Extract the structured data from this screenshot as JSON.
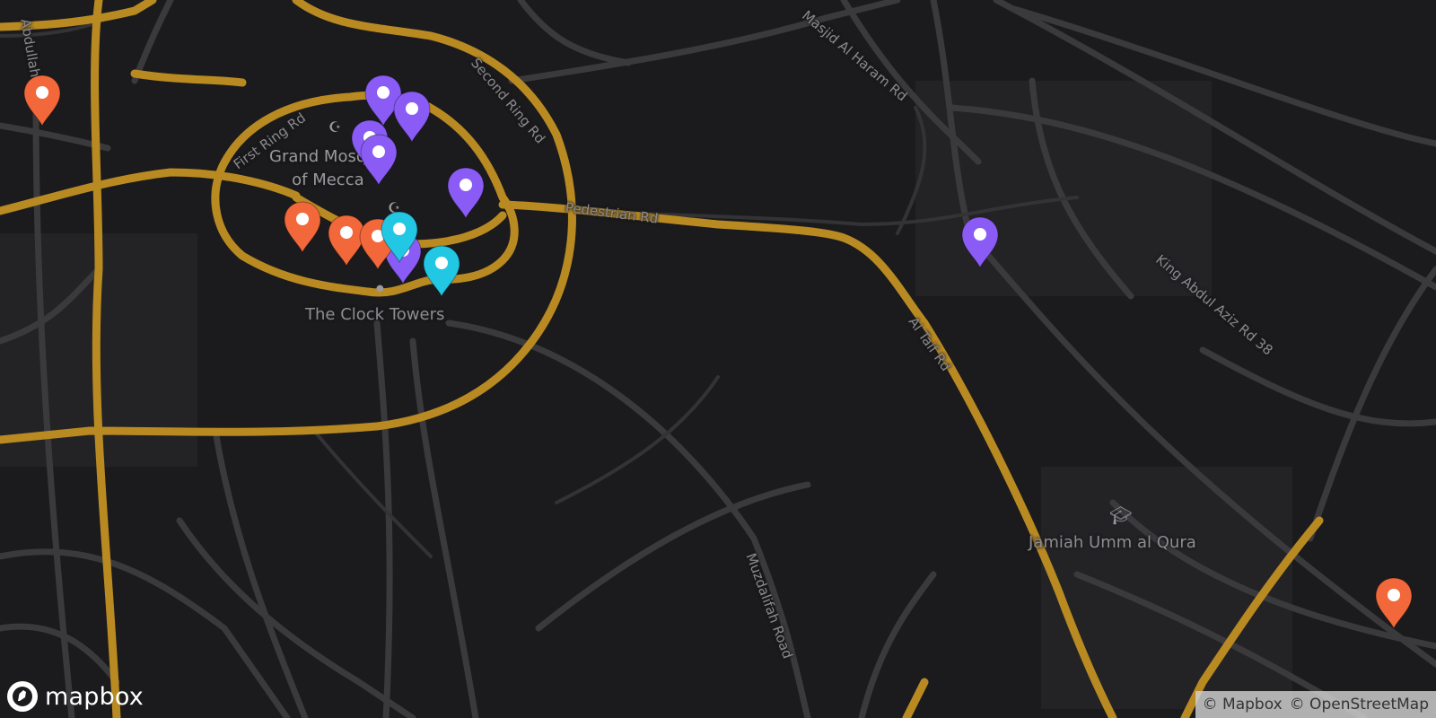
{
  "map": {
    "place_labels": [
      {
        "id": "grand-mosque",
        "text": "Grand Mosque\nof Mecca"
      },
      {
        "id": "clock-towers",
        "text": "The Clock Towers"
      },
      {
        "id": "umm-al-qura",
        "text": "Jamiah Umm al Qura"
      }
    ],
    "road_labels": [
      {
        "id": "first-ring",
        "text": "First Ring Rd"
      },
      {
        "id": "second-ring",
        "text": "Second Ring Rd"
      },
      {
        "id": "masjid-al-haram",
        "text": "Masjid Al Haram Rd"
      },
      {
        "id": "pedestrian",
        "text": "Pedestrian Rd"
      },
      {
        "id": "al-taif",
        "text": "Al Taif Rd"
      },
      {
        "id": "king-abdul-aziz",
        "text": "King Abdul Aziz Rd 38"
      },
      {
        "id": "muzdalifah",
        "text": "Muzdalifah Road"
      },
      {
        "id": "abdullah",
        "text": "Abdullah"
      }
    ],
    "marker_colors": {
      "purple": "#8a5cf5",
      "orange": "#f2683a",
      "cyan": "#22c7e3"
    },
    "markers": [
      {
        "color": "orange",
        "id": "m1"
      },
      {
        "color": "purple",
        "id": "m2"
      },
      {
        "color": "purple",
        "id": "m3"
      },
      {
        "color": "purple",
        "id": "m4"
      },
      {
        "color": "purple",
        "id": "m5"
      },
      {
        "color": "purple",
        "id": "m6"
      },
      {
        "color": "orange",
        "id": "m7"
      },
      {
        "color": "orange",
        "id": "m8"
      },
      {
        "color": "purple",
        "id": "m9"
      },
      {
        "color": "orange",
        "id": "m10"
      },
      {
        "color": "cyan",
        "id": "m11"
      },
      {
        "color": "cyan",
        "id": "m12"
      },
      {
        "color": "purple",
        "id": "m13"
      },
      {
        "color": "orange",
        "id": "m14"
      }
    ]
  },
  "logo": {
    "text": "mapbox"
  },
  "attribution": {
    "mapbox": "© Mapbox",
    "osm": "© OpenStreetMap"
  },
  "colors": {
    "background": "#1b1b1d",
    "major_road": "#b98a22",
    "minor_road": "#3a3a3d"
  }
}
